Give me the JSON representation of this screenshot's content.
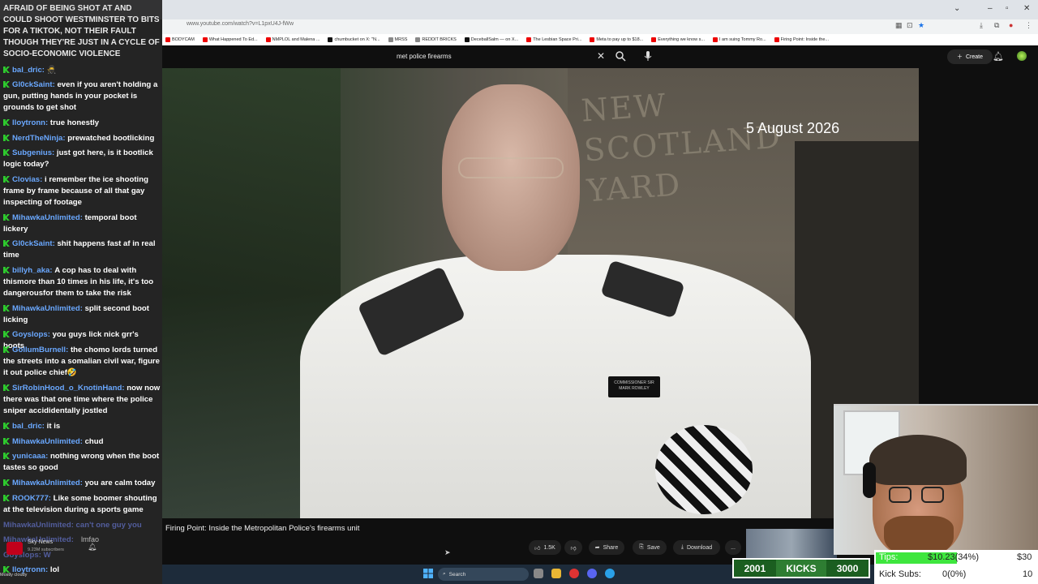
{
  "browser": {
    "url": "www.youtube.com/watch?v=L1pxU4J-fWw",
    "bookmarks": [
      "BODYCAM",
      "What Happened To Ed...",
      "NMPLOL and Malena ...",
      "chumbucket on X: \"N...",
      "MRSS",
      "REDDIT BRICKS",
      "DeceballSalm — on X...",
      "The Lesbian Space Pri...",
      "Meta to pay up to $18...",
      "Everything we know s...",
      "I am suing Tommy Ro...",
      "Firing Point: Inside the..."
    ]
  },
  "youtube": {
    "search_query": "met police firearms",
    "create_label": "Create",
    "video": {
      "overlay_date": "5 August 2026",
      "sign_text": "NEW SCOTLAND YARD",
      "badge_text": "COMMISSIONER SIR MARK ROWLEY",
      "title": "Firing Point: Inside the Metropolitan Police's firearms unit",
      "channel_name": "Sky News",
      "channel_subs": "9.23M subscribers",
      "likes": "1.5K",
      "share_label": "Share",
      "save_label": "Save",
      "download_label": "Download",
      "more_label": "..."
    }
  },
  "taskbar": {
    "search_label": "Search",
    "weather": "Mostly cloudy"
  },
  "chat": {
    "faded_header": "AFRAID OF BEING SHOT AT AND COULD SHOOT WESTMINSTER TO BITS FOR A TIKTOK, NOT THEIR FAULT THOUGH THEY'RE JUST IN A CYCLE OF SOCIO-ECONOMIC VIOLENCE",
    "messages": [
      {
        "user": "bal_dric:",
        "text": "🥷"
      },
      {
        "user": "Gl0ckSaint:",
        "text": "even if you aren't holding a gun, putting hands in your pocket is grounds to get shot"
      },
      {
        "user": "lloytronn:",
        "text": "true honestly"
      },
      {
        "user": "NerdTheNinja:",
        "text": "prewatched bootlicking"
      },
      {
        "user": "Subgenius:",
        "text": "just got here, is it bootlick logic today?"
      },
      {
        "user": "Clovias:",
        "text": "i remember the ice shooting frame by frame because of all that gay inspecting of footage"
      },
      {
        "user": "MihawkaUnlimited:",
        "text": "temporal boot lickery"
      },
      {
        "user": "Gl0ckSaint:",
        "text": "shit happens fast af in real time"
      },
      {
        "user": "billyh_aka:",
        "text": "A cop has to deal with thismore than 10 times in his life, it's too dangerousfor them to take the risk"
      },
      {
        "user": "MihawkaUnlimited:",
        "text": "split second boot licking"
      },
      {
        "user": "Goyslops:",
        "text": "you guys lick nick grr's boots"
      },
      {
        "user": "GollumBurnell:",
        "text": "the chomo lords turned the streets into a somalian civil war, figure it out police chief🤣"
      },
      {
        "user": "SirRobinHood_o_KnotinHand:",
        "text": "now now there was that one time where the police sniper accididentally jostled"
      },
      {
        "user": "bal_dric:",
        "text": "it is"
      },
      {
        "user": "MihawkaUnlimited:",
        "text": "chud"
      },
      {
        "user": "yunicaaa:",
        "text": "nothing wrong when the boot tastes so good"
      },
      {
        "user": "MihawkaUnlimited:",
        "text": "you are calm today"
      },
      {
        "user": "ROOK777:",
        "text": "Like some boomer shouting at the television during a sports game"
      },
      {
        "user": "lloytronn:",
        "text": "lol"
      }
    ],
    "overlap_a": "MihawkaUnlimited: can't one guy you",
    "overlap_b": "MihawkaUnlimited:",
    "overlap_b2": "lmfao",
    "overlap_c": "Goyslops: W"
  },
  "stream": {
    "kicks_left": "2001",
    "kicks_label": "KICKS",
    "kicks_right": "3000",
    "tips_label": "Tips:",
    "tips_amount": "$10.23(34%)",
    "tips_goal": "$30",
    "subs_label": "Kick Subs:",
    "subs_amount": "0(0%)",
    "subs_goal": "10",
    "colors": {
      "kick_green": "#2ecc2e",
      "username_blue": "#6aa8ff",
      "youtube_red": "#ff0000"
    }
  }
}
